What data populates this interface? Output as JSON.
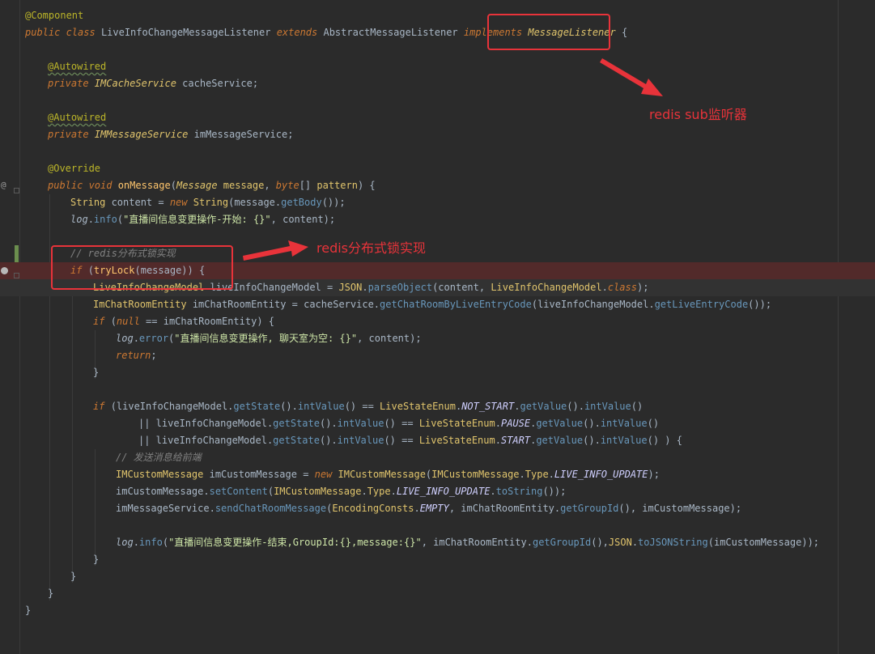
{
  "gutter": {
    "override_marker": "@"
  },
  "lines": [
    [
      [
        "@Component",
        "t-ann"
      ]
    ],
    [
      [
        "public ",
        "t-kw"
      ],
      [
        "class ",
        "t-kw"
      ],
      [
        "LiveInfoChangeMessageListener ",
        "t-type"
      ],
      [
        "extends ",
        "t-kw"
      ],
      [
        "AbstractMessageListener ",
        "t-type"
      ],
      [
        "implements ",
        "t-kw"
      ],
      [
        "MessageListener",
        "t-itype"
      ],
      [
        " {",
        "t-type"
      ]
    ],
    [],
    [
      [
        "@Autowired",
        "t-ann-u"
      ]
    ],
    [
      [
        "private ",
        "t-kw"
      ],
      [
        "IMCacheService ",
        "t-itype"
      ],
      [
        "cacheService;",
        "t-type"
      ]
    ],
    [],
    [
      [
        "@Autowired",
        "t-ann-u"
      ]
    ],
    [
      [
        "private ",
        "t-kw"
      ],
      [
        "IMMessageService ",
        "t-itype"
      ],
      [
        "imMessageService;",
        "t-type"
      ]
    ],
    [],
    [
      [
        "@Override",
        "t-ann"
      ]
    ],
    [
      [
        "public ",
        "t-kw"
      ],
      [
        "void ",
        "t-kw"
      ],
      [
        "onMessage",
        "t-fn"
      ],
      [
        "(",
        "t-type"
      ],
      [
        "Message ",
        "t-itype"
      ],
      [
        "message",
        "t-param"
      ],
      [
        ", ",
        "t-type"
      ],
      [
        "byte",
        "t-kw"
      ],
      [
        "[] ",
        "t-type"
      ],
      [
        "pattern",
        "t-param"
      ],
      [
        ") {",
        "t-type"
      ]
    ],
    [
      [
        "String ",
        "t-ctype"
      ],
      [
        "content = ",
        "t-type"
      ],
      [
        "new ",
        "t-kw"
      ],
      [
        "String",
        "t-ctype"
      ],
      [
        "(message.",
        "t-type"
      ],
      [
        "getBody",
        "t-call"
      ],
      [
        "());",
        "t-type"
      ]
    ],
    [
      [
        "log",
        "t-static"
      ],
      [
        ".",
        "t-type"
      ],
      [
        "info",
        "t-call"
      ],
      [
        "(",
        "t-type"
      ],
      [
        "\"直播间信息变更操作-开始: {}\"",
        "t-str"
      ],
      [
        ", content);",
        "t-type"
      ]
    ],
    [],
    [
      [
        "// redis分布式锁实现",
        "t-cmt"
      ]
    ],
    [
      [
        "if ",
        "t-kw"
      ],
      [
        "(",
        "t-type"
      ],
      [
        "tryLock",
        "t-fn"
      ],
      [
        "(message)) {",
        "t-type"
      ]
    ],
    [
      [
        "LiveInfoChangeModel ",
        "t-ctype"
      ],
      [
        "liveInfoChangeModel = ",
        "t-type"
      ],
      [
        "JSON",
        "t-ctype"
      ],
      [
        ".",
        "t-type"
      ],
      [
        "parseObject",
        "t-call"
      ],
      [
        "(content, ",
        "t-type"
      ],
      [
        "LiveInfoChangeModel",
        "t-ctype"
      ],
      [
        ".",
        "t-type"
      ],
      [
        "class",
        "t-kw"
      ],
      [
        ");",
        "t-type"
      ]
    ],
    [
      [
        "ImChatRoomEntity ",
        "t-ctype"
      ],
      [
        "imChatRoomEntity = cacheService.",
        "t-type"
      ],
      [
        "getChatRoomByLiveEntryCode",
        "t-call"
      ],
      [
        "(liveInfoChangeModel.",
        "t-type"
      ],
      [
        "getLiveEntryCode",
        "t-call"
      ],
      [
        "());",
        "t-type"
      ]
    ],
    [
      [
        "if ",
        "t-kw"
      ],
      [
        "(",
        "t-type"
      ],
      [
        "null ",
        "t-kw"
      ],
      [
        "== imChatRoomEntity) {",
        "t-type"
      ]
    ],
    [
      [
        "log",
        "t-static"
      ],
      [
        ".",
        "t-type"
      ],
      [
        "error",
        "t-call"
      ],
      [
        "(",
        "t-type"
      ],
      [
        "\"直播间信息变更操作, 聊天室为空: {}\"",
        "t-str"
      ],
      [
        ", content);",
        "t-type"
      ]
    ],
    [
      [
        "return",
        "t-kw"
      ],
      [
        ";",
        "t-type"
      ]
    ],
    [
      [
        "}",
        "t-type"
      ]
    ],
    [],
    [
      [
        "if ",
        "t-kw"
      ],
      [
        "(liveInfoChangeModel.",
        "t-type"
      ],
      [
        "getState",
        "t-call"
      ],
      [
        "().",
        "t-type"
      ],
      [
        "intValue",
        "t-call"
      ],
      [
        "() == ",
        "t-type"
      ],
      [
        "LiveStateEnum",
        "t-ctype"
      ],
      [
        ".",
        "t-type"
      ],
      [
        "NOT_START",
        "t-const"
      ],
      [
        ".",
        "t-type"
      ],
      [
        "getValue",
        "t-call"
      ],
      [
        "().",
        "t-type"
      ],
      [
        "intValue",
        "t-call"
      ],
      [
        "()",
        "t-type"
      ]
    ],
    [
      [
        "|| liveInfoChangeModel.",
        "t-type"
      ],
      [
        "getState",
        "t-call"
      ],
      [
        "().",
        "t-type"
      ],
      [
        "intValue",
        "t-call"
      ],
      [
        "() == ",
        "t-type"
      ],
      [
        "LiveStateEnum",
        "t-ctype"
      ],
      [
        ".",
        "t-type"
      ],
      [
        "PAUSE",
        "t-const"
      ],
      [
        ".",
        "t-type"
      ],
      [
        "getValue",
        "t-call"
      ],
      [
        "().",
        "t-type"
      ],
      [
        "intValue",
        "t-call"
      ],
      [
        "()",
        "t-type"
      ]
    ],
    [
      [
        "|| liveInfoChangeModel.",
        "t-type"
      ],
      [
        "getState",
        "t-call"
      ],
      [
        "().",
        "t-type"
      ],
      [
        "intValue",
        "t-call"
      ],
      [
        "() == ",
        "t-type"
      ],
      [
        "LiveStateEnum",
        "t-ctype"
      ],
      [
        ".",
        "t-type"
      ],
      [
        "START",
        "t-const"
      ],
      [
        ".",
        "t-type"
      ],
      [
        "getValue",
        "t-call"
      ],
      [
        "().",
        "t-type"
      ],
      [
        "intValue",
        "t-call"
      ],
      [
        "() ) {",
        "t-type"
      ]
    ],
    [
      [
        "// 发送消息给前端",
        "t-cmt"
      ]
    ],
    [
      [
        "IMCustomMessage ",
        "t-ctype"
      ],
      [
        "imCustomMessage = ",
        "t-type"
      ],
      [
        "new ",
        "t-kw"
      ],
      [
        "IMCustomMessage",
        "t-ctype"
      ],
      [
        "(",
        "t-type"
      ],
      [
        "IMCustomMessage",
        "t-ctype"
      ],
      [
        ".",
        "t-type"
      ],
      [
        "Type",
        "t-ctype"
      ],
      [
        ".",
        "t-type"
      ],
      [
        "LIVE_INFO_UPDATE",
        "t-const"
      ],
      [
        ");",
        "t-type"
      ]
    ],
    [
      [
        "imCustomMessage.",
        "t-type"
      ],
      [
        "setContent",
        "t-call"
      ],
      [
        "(",
        "t-type"
      ],
      [
        "IMCustomMessage",
        "t-ctype"
      ],
      [
        ".",
        "t-type"
      ],
      [
        "Type",
        "t-ctype"
      ],
      [
        ".",
        "t-type"
      ],
      [
        "LIVE_INFO_UPDATE",
        "t-const"
      ],
      [
        ".",
        "t-type"
      ],
      [
        "toString",
        "t-call"
      ],
      [
        "());",
        "t-type"
      ]
    ],
    [
      [
        "imMessageService.",
        "t-type"
      ],
      [
        "sendChatRoomMessage",
        "t-call"
      ],
      [
        "(",
        "t-type"
      ],
      [
        "EncodingConsts",
        "t-ctype"
      ],
      [
        ".",
        "t-type"
      ],
      [
        "EMPTY",
        "t-const"
      ],
      [
        ", imChatRoomEntity.",
        "t-type"
      ],
      [
        "getGroupId",
        "t-call"
      ],
      [
        "(), imCustomMessage);",
        "t-type"
      ]
    ],
    [],
    [
      [
        "log",
        "t-static"
      ],
      [
        ".",
        "t-type"
      ],
      [
        "info",
        "t-call"
      ],
      [
        "(",
        "t-type"
      ],
      [
        "\"直播间信息变更操作-结束,GroupId:{},message:{}\"",
        "t-str"
      ],
      [
        ", imChatRoomEntity.",
        "t-type"
      ],
      [
        "getGroupId",
        "t-call"
      ],
      [
        "(),",
        "t-type"
      ],
      [
        "JSON",
        "t-ctype"
      ],
      [
        ".",
        "t-type"
      ],
      [
        "toJSONString",
        "t-call"
      ],
      [
        "(imCustomMessage));",
        "t-type"
      ]
    ],
    [
      [
        "}",
        "t-type"
      ]
    ],
    [
      [
        "}",
        "t-type"
      ]
    ],
    [
      [
        "}",
        "t-type"
      ]
    ],
    [
      [
        "}",
        "t-type"
      ]
    ]
  ],
  "annotations": {
    "listener": "redis sub监听器",
    "lock": "redis分布式锁实现"
  },
  "colors": {
    "annotation": "#e8333a",
    "editor_bg": "#2b2b2b",
    "breakpoint_line": "#522a2a"
  }
}
